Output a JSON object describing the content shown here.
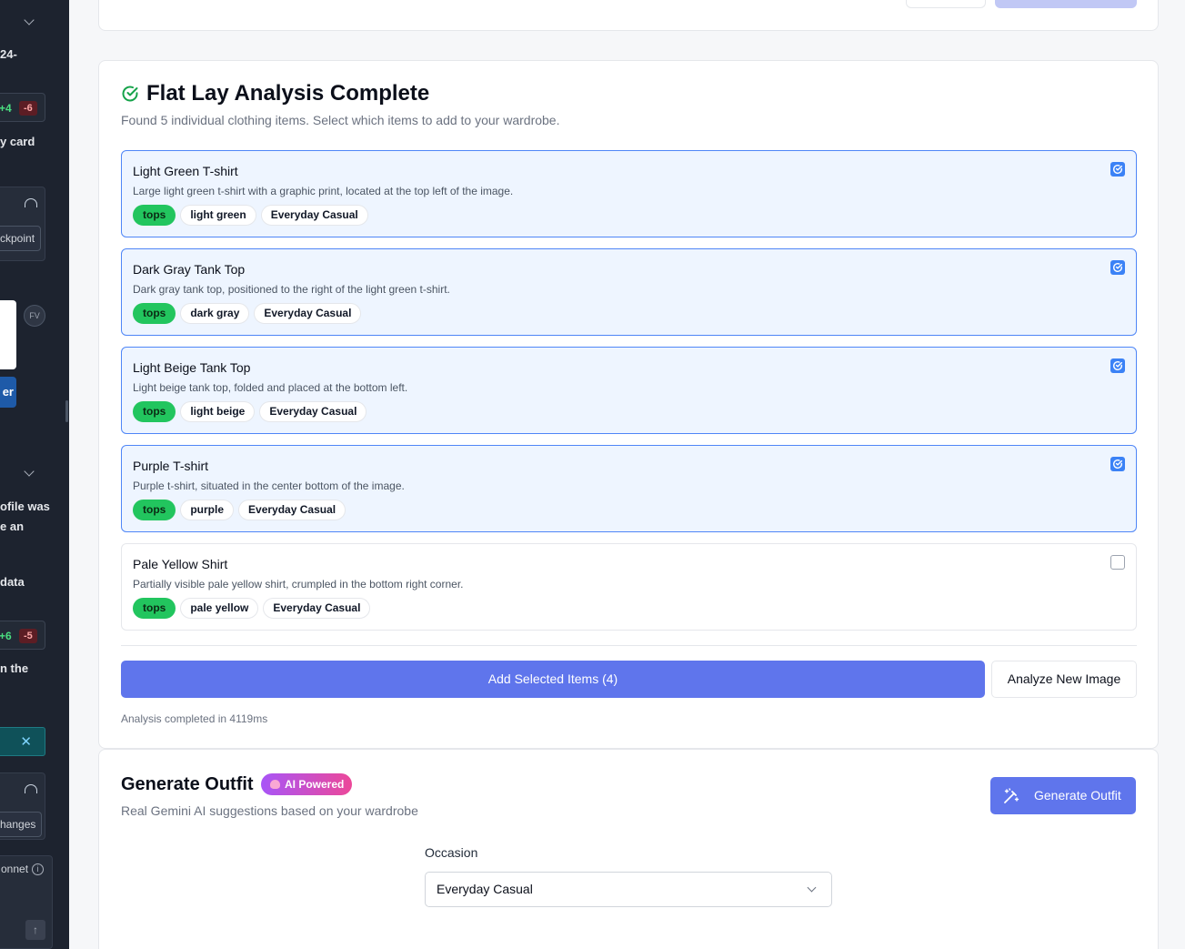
{
  "sidebar": {
    "text_1": "24-",
    "diff_1": {
      "plus": "+4",
      "minus": "-6"
    },
    "text_2": "y card",
    "checkpoint_label": "ckpoint",
    "fv_label": "FV",
    "blue_btn_label": "er",
    "text_3": "ofile was",
    "text_4": "e an",
    "text_5": "data",
    "diff_2": {
      "plus": "+6",
      "minus": "-5"
    },
    "text_6": "n the",
    "close_glyph": "✕",
    "changes_label": "hanges",
    "model_label": "onnet",
    "info_glyph": "i",
    "up_glyph": "↑"
  },
  "analysis": {
    "title": "Flat Lay Analysis Complete",
    "subtitle": "Found 5 individual clothing items. Select which items to add to your wardrobe.",
    "items": [
      {
        "name": "Light Green T-shirt",
        "description": "Large light green t-shirt with a graphic print, located at the top left of the image.",
        "category": "tops",
        "color": "light green",
        "occasion": "Everyday Casual",
        "selected": true
      },
      {
        "name": "Dark Gray Tank Top",
        "description": "Dark gray tank top, positioned to the right of the light green t-shirt.",
        "category": "tops",
        "color": "dark gray",
        "occasion": "Everyday Casual",
        "selected": true
      },
      {
        "name": "Light Beige Tank Top",
        "description": "Light beige tank top, folded and placed at the bottom left.",
        "category": "tops",
        "color": "light beige",
        "occasion": "Everyday Casual",
        "selected": true
      },
      {
        "name": "Purple T-shirt",
        "description": "Purple t-shirt, situated in the center bottom of the image.",
        "category": "tops",
        "color": "purple",
        "occasion": "Everyday Casual",
        "selected": true
      },
      {
        "name": "Pale Yellow Shirt",
        "description": "Partially visible pale yellow shirt, crumpled in the bottom right corner.",
        "category": "tops",
        "color": "pale yellow",
        "occasion": "Everyday Casual",
        "selected": false
      }
    ],
    "add_button_label": "Add Selected Items (4)",
    "new_image_button_label": "Analyze New Image",
    "elapsed_text": "Analysis completed in 4119ms"
  },
  "outfit": {
    "title": "Generate Outfit",
    "badge_label": "AI Powered",
    "subtitle": "Real Gemini AI suggestions based on your wardrobe",
    "generate_button_label": "Generate Outfit",
    "occasion_label": "Occasion",
    "occasion_value": "Everyday Casual"
  },
  "colors": {
    "accent": "#5f75ec",
    "selected_border": "#4f86f7",
    "selected_bg": "#eef5ff",
    "tag_green": "#22c55e",
    "success_icon": "#16a34a"
  }
}
